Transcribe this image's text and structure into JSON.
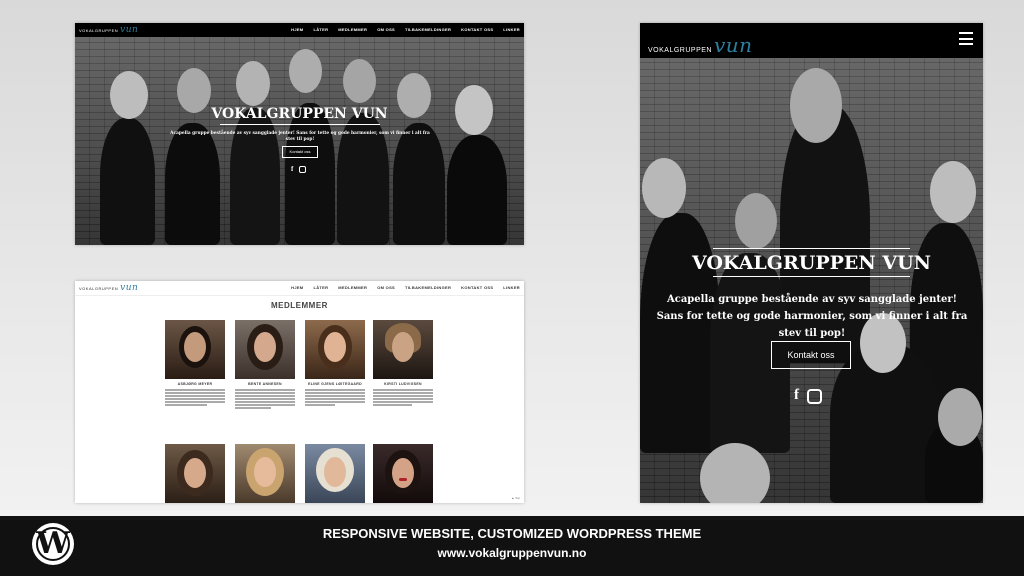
{
  "desktop_hero": {
    "logo_prefix": "VOKALGRUPPEN",
    "logo_script": "vun",
    "nav": [
      "HJEM",
      "LÅTER",
      "MEDLEMMER",
      "OM OSS",
      "TILBAKEMELDINGER",
      "KONTAKT OSS",
      "LINKER"
    ],
    "title": "VOKALGRUPPEN VUN",
    "tagline": "Acapella gruppe bestående av syv sangglade jenter! Sans for tette og gode harmonier, som vi finner i alt fra stev til pop!",
    "button": "Kontakt oss",
    "social_icons": [
      "facebook-icon",
      "instagram-icon"
    ]
  },
  "members_page": {
    "logo_prefix": "VOKALGRUPPEN",
    "logo_script": "vun",
    "nav": [
      "HJEM",
      "LÅTER",
      "MEDLEMMER",
      "OM OSS",
      "TILBAKEMELDINGER",
      "KONTAKT OSS",
      "LINKER"
    ],
    "title": "MEDLEMMER",
    "members": [
      {
        "name": "ASBJØRG MEYER"
      },
      {
        "name": "BENTE ANNESEN"
      },
      {
        "name": "ELINE GJENS LØITEGAARD"
      },
      {
        "name": "KIRSTI LUDVIGSEN"
      },
      {
        "name": ""
      },
      {
        "name": ""
      },
      {
        "name": ""
      },
      {
        "name": ""
      }
    ],
    "pager": "▲ Top"
  },
  "mobile_hero": {
    "logo_prefix": "VOKALGRUPPEN",
    "logo_script": "vun",
    "title": "VOKALGRUPPEN VUN",
    "tagline": "Acapella gruppe bestående av syv sangglade jenter! Sans for tette og gode harmonier, som vi finner i alt fra stev til pop!",
    "button": "Kontakt oss"
  },
  "footer": {
    "icon": "wordpress-icon",
    "line1": "RESPONSIVE WEBSITE, CUSTOMIZED WORDPRESS THEME",
    "line2": "www.vokalgruppenvun.no"
  }
}
